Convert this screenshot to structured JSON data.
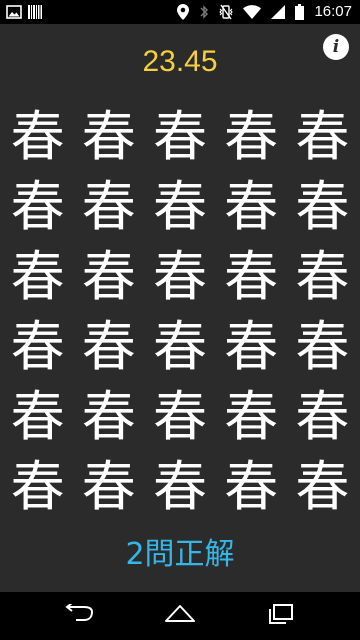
{
  "status_bar": {
    "time": "16:07",
    "left_icons": [
      "image-icon",
      "barcode-icon"
    ],
    "right_icons": [
      "location-icon",
      "bluetooth-icon",
      "vibrate-icon",
      "wifi-icon",
      "signal-icon",
      "battery-icon"
    ]
  },
  "game": {
    "timer": "23.45",
    "info_icon": "i",
    "grid": [
      [
        "春",
        "春",
        "春",
        "春",
        "春"
      ],
      [
        "春",
        "春",
        "春",
        "春",
        "春"
      ],
      [
        "春",
        "春",
        "春",
        "春",
        "春"
      ],
      [
        "春",
        "春",
        "春",
        "春",
        "春"
      ],
      [
        "春",
        "春",
        "春",
        "春",
        "春"
      ],
      [
        "春",
        "春",
        "春",
        "春",
        "春"
      ]
    ],
    "score": "2問正解",
    "colors": {
      "background": "#2b2b2b",
      "timer": "#f4d03f",
      "score": "#35b6e8",
      "character": "#ffffff"
    }
  },
  "nav_bar": {
    "buttons": [
      "back-icon",
      "home-icon",
      "recents-icon"
    ]
  }
}
